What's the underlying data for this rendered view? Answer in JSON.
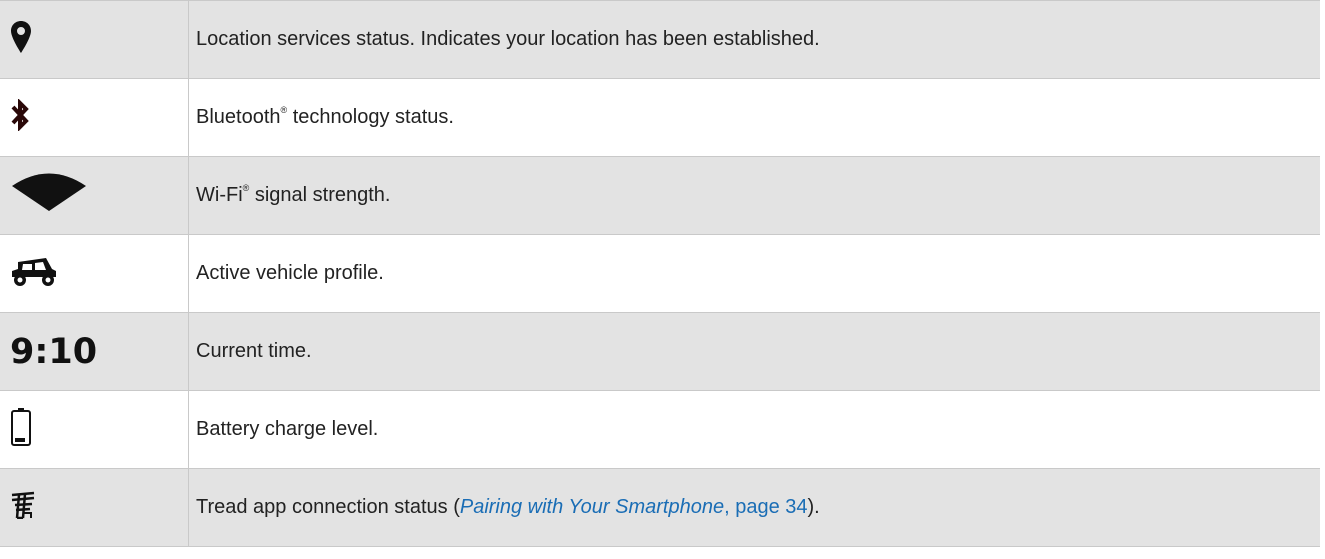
{
  "rows": [
    {
      "icon": "location-pin-icon",
      "text": "Location services status. Indicates your location has been established."
    },
    {
      "icon": "bluetooth-icon",
      "text_before": "Bluetooth",
      "sup": "®",
      "text_after": " technology status."
    },
    {
      "icon": "wifi-icon",
      "text_before": "Wi-Fi",
      "sup": "®",
      "text_after": " signal strength."
    },
    {
      "icon": "off-road-vehicle-icon",
      "text": "Active vehicle profile."
    },
    {
      "icon_text": "9:10",
      "text": "Current time."
    },
    {
      "icon": "battery-icon",
      "text": "Battery charge level."
    },
    {
      "icon": "tread-app-icon",
      "text_before": "Tread app connection status (",
      "link_text": "Pairing with Your Smartphone",
      "link_sep": ", ",
      "page_text": "page 34",
      "text_after": ")."
    }
  ]
}
